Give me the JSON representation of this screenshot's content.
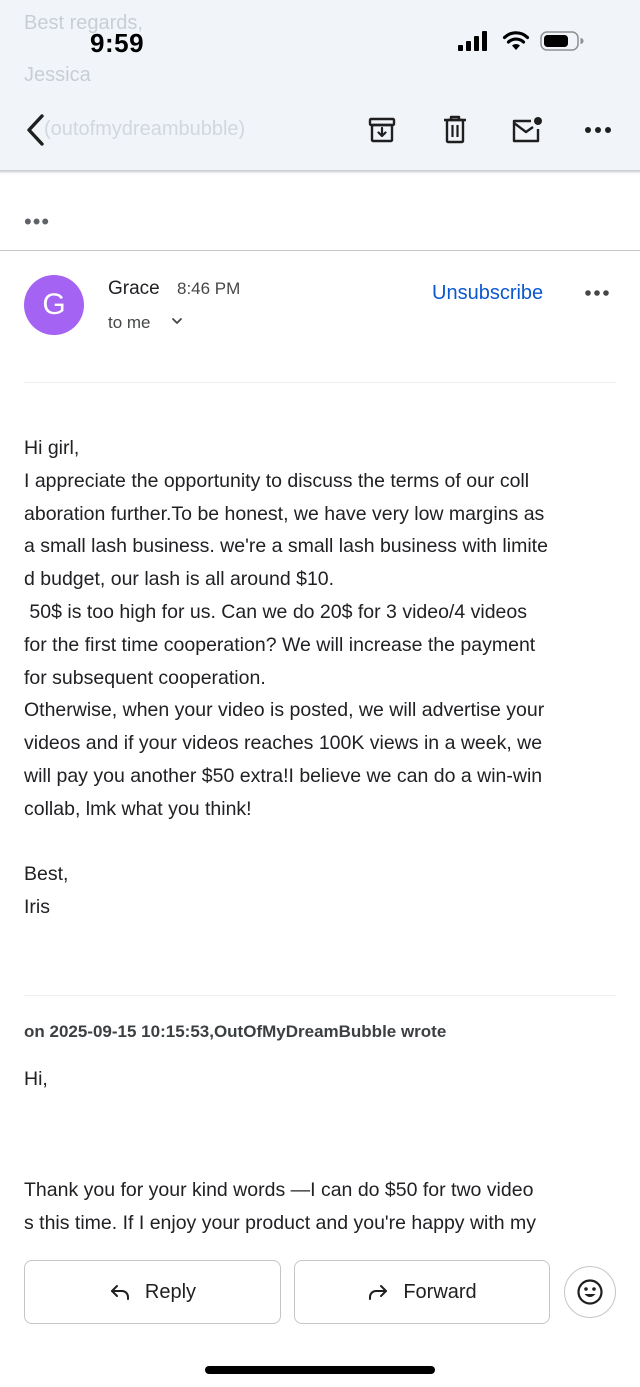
{
  "status_bar": {
    "time": "9:59"
  },
  "background_preview": {
    "line1": "Best regards,",
    "line2": "Jessica",
    "line3": "(outofmydreambubble)"
  },
  "toolbar": {
    "back_icon": "chevron-left-icon",
    "archive_icon": "archive-icon",
    "delete_icon": "trash-icon",
    "mark_unread_icon": "mail-unread-icon",
    "more_icon": "more-horizontal-icon"
  },
  "collapsed": {
    "label": "•••"
  },
  "message": {
    "avatar_letter": "G",
    "avatar_color": "#a463f2",
    "sender": "Grace",
    "time": "8:46 PM",
    "recipient": "to me",
    "unsubscribe": "Unsubscribe",
    "body_lines": [
      "Hi girl,",
      "I appreciate the opportunity to discuss the terms of our coll",
      "aboration further.To be honest, we have very low margins as",
      "a small lash business. we're a small lash business with limite",
      "d budget, our lash is all around $10.",
      " 50$ is too high for us. Can we do 20$ for 3 video/4 videos",
      "for the first time cooperation? We will increase the payment",
      "for subsequent cooperation.",
      "Otherwise, when your video is posted, we will advertise your",
      "videos and if your videos reaches 100K views in a week, we",
      "will pay you another $50 extra!I believe we can do a win-win",
      "collab, lmk what you think!"
    ],
    "signoff": "Best,",
    "signature": "Iris"
  },
  "quoted": {
    "header": "on 2025-09-15 10:15:53,OutOfMyDreamBubble wrote",
    "greeting": "Hi,",
    "lines": [
      "Thank you for your kind words —I can do $50 for two video",
      "s this time. If I enjoy your product and you're happy with my"
    ]
  },
  "actions": {
    "reply": "Reply",
    "forward": "Forward",
    "emoji_icon": "smiley-icon"
  },
  "colors": {
    "accent": "#0b57d0",
    "header_bg": "#f1f4f9"
  }
}
